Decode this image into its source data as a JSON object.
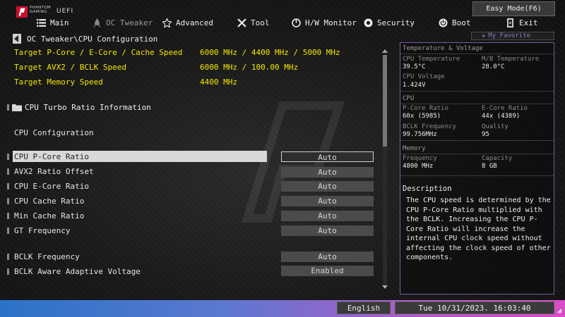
{
  "brand": {
    "line1": "PHANTOM",
    "line2": "GAMING",
    "uefi": "UEFI"
  },
  "easy_mode_button": "Easy Mode(F6)",
  "tabs": [
    {
      "label": "Main",
      "icon": "list-icon"
    },
    {
      "label": "OC Tweaker",
      "icon": "rocket-icon"
    },
    {
      "label": "Advanced",
      "icon": "star-icon"
    },
    {
      "label": "Tool",
      "icon": "wrench-icon"
    },
    {
      "label": "H/W Monitor",
      "icon": "monitor-icon"
    },
    {
      "label": "Security",
      "icon": "shield-icon"
    },
    {
      "label": "Boot",
      "icon": "power-icon"
    },
    {
      "label": "Exit",
      "icon": "exit-icon"
    }
  ],
  "breadcrumb": "OC Tweaker\\CPU Configuration",
  "favorite": "My Favorite",
  "targets": [
    {
      "label": "Target P-Core / E-Core / Cache Speed",
      "value": "6000 MHz / 4400 MHz / 5000 MHz"
    },
    {
      "label": "Target AVX2 / BCLK Speed",
      "value": "6000 MHz / 100.00 MHz"
    },
    {
      "label": "Target Memory Speed",
      "value": "4400 MHz"
    }
  ],
  "folder_item": "CPU Turbo Ratio Information",
  "section_title": "CPU Configuration",
  "settings": [
    {
      "label": "CPU P-Core Ratio",
      "value": "Auto"
    },
    {
      "label": "AVX2 Ratio Offset",
      "value": "Auto"
    },
    {
      "label": "CPU E-Core Ratio",
      "value": "Auto"
    },
    {
      "label": "CPU Cache  Ratio",
      "value": "Auto"
    },
    {
      "label": "Min Cache  Ratio",
      "value": "Auto"
    },
    {
      "label": "GT Frequency",
      "value": "Auto"
    },
    {
      "label": "BCLK Frequency",
      "value": "Auto"
    },
    {
      "label": "BCLK Aware Adaptive Voltage",
      "value": "Enabled"
    }
  ],
  "monitor": {
    "temp_header": "Temperature & Voltage",
    "cpu_temp_label": "CPU Temperature",
    "cpu_temp": "39.5°C",
    "mb_temp_label": "M/B Temperature",
    "mb_temp": "28.0°C",
    "cpu_volt_label": "CPU Voltage",
    "cpu_volt": "1.424V",
    "cpu_header": "CPU",
    "pcore_label": "P-Core Ratio",
    "pcore": "60x (5985)",
    "ecore_label": "E-Core Ratio",
    "ecore": "44x (4389)",
    "bclk_label": "BCLK Frequency",
    "bclk": "99.756MHz",
    "quality_label": "Quality",
    "quality": "95",
    "mem_header": "Memory",
    "freq_label": "Frequency",
    "freq": "4800 MHz",
    "cap_label": "Capacity",
    "cap": "8 GB"
  },
  "description": {
    "header": "Description",
    "text": "The CPU speed is determined by the CPU P-Core Ratio multiplied with the BCLK. Increasing the CPU P-Core Ratio will increase the internal CPU clock speed without affecting the clock speed of other components."
  },
  "footer": {
    "language": "English",
    "datetime": "Tue 10/31/2023. 16:03:40"
  }
}
